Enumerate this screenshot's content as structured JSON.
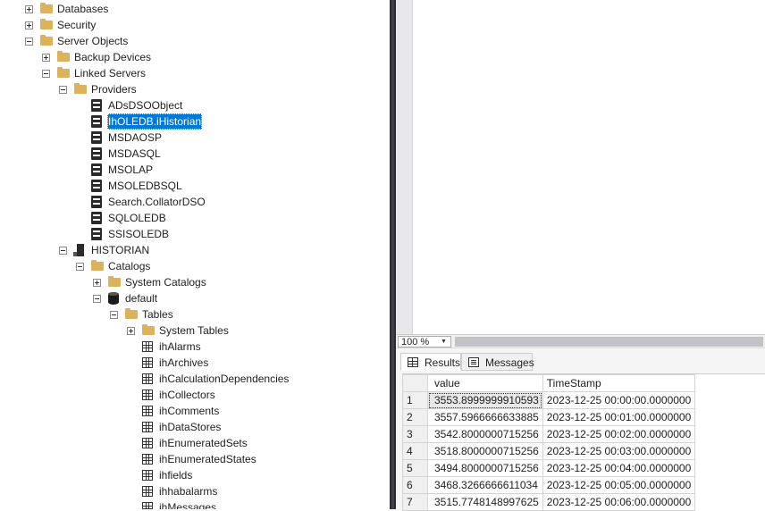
{
  "tree": {
    "nodes": [
      {
        "label": "Databases",
        "icon": "folder-icon",
        "expander": "plus"
      },
      {
        "label": "Security",
        "icon": "folder-icon",
        "expander": "plus"
      },
      {
        "label": "Server Objects",
        "icon": "folder-icon",
        "expander": "minus"
      },
      {
        "label": "Backup Devices",
        "icon": "folder-icon",
        "expander": "plus"
      },
      {
        "label": "Linked Servers",
        "icon": "folder-icon",
        "expander": "minus"
      },
      {
        "label": "Providers",
        "icon": "folder-icon",
        "expander": "minus"
      },
      {
        "label": "ADsDSOObject",
        "icon": "provider-icon",
        "expander": ""
      },
      {
        "label": "IhOLEDB.iHistorian",
        "icon": "provider-icon",
        "expander": "",
        "selected": true
      },
      {
        "label": "MSDAOSP",
        "icon": "provider-icon",
        "expander": ""
      },
      {
        "label": "MSDASQL",
        "icon": "provider-icon",
        "expander": ""
      },
      {
        "label": "MSOLAP",
        "icon": "provider-icon",
        "expander": ""
      },
      {
        "label": "MSOLEDBSQL",
        "icon": "provider-icon",
        "expander": ""
      },
      {
        "label": "Search.CollatorDSO",
        "icon": "provider-icon",
        "expander": ""
      },
      {
        "label": "SQLOLEDB",
        "icon": "provider-icon",
        "expander": ""
      },
      {
        "label": "SSISOLEDB",
        "icon": "provider-icon",
        "expander": ""
      },
      {
        "label": "HISTORIAN",
        "icon": "server-icon",
        "expander": "minus"
      },
      {
        "label": "Catalogs",
        "icon": "folder-icon",
        "expander": "minus"
      },
      {
        "label": "System Catalogs",
        "icon": "folder-icon",
        "expander": "plus"
      },
      {
        "label": "default",
        "icon": "database-icon",
        "expander": "minus"
      },
      {
        "label": "Tables",
        "icon": "folder-icon",
        "expander": "minus"
      },
      {
        "label": "System Tables",
        "icon": "folder-icon",
        "expander": "plus"
      },
      {
        "label": "ihAlarms",
        "icon": "table-icon",
        "expander": ""
      },
      {
        "label": "ihArchives",
        "icon": "table-icon",
        "expander": ""
      },
      {
        "label": "ihCalculationDependencies",
        "icon": "table-icon",
        "expander": ""
      },
      {
        "label": "ihCollectors",
        "icon": "table-icon",
        "expander": ""
      },
      {
        "label": "ihComments",
        "icon": "table-icon",
        "expander": ""
      },
      {
        "label": "ihDataStores",
        "icon": "table-icon",
        "expander": ""
      },
      {
        "label": "ihEnumeratedSets",
        "icon": "table-icon",
        "expander": ""
      },
      {
        "label": "ihEnumeratedStates",
        "icon": "table-icon",
        "expander": ""
      },
      {
        "label": "ihfields",
        "icon": "table-icon",
        "expander": ""
      },
      {
        "label": "ihhabalarms",
        "icon": "table-icon",
        "expander": ""
      },
      {
        "label": "ihMessages",
        "icon": "table-icon",
        "expander": ""
      }
    ]
  },
  "zoom": {
    "value": "100 %"
  },
  "results": {
    "tabs": [
      {
        "label": "Results",
        "icon": "grid-icon",
        "active": true
      },
      {
        "label": "Messages",
        "icon": "messages-icon",
        "active": false
      }
    ],
    "columns": [
      "value",
      "TimeStamp"
    ],
    "rows": [
      {
        "n": "1",
        "value": "3553.8999999910593",
        "time": "2023-12-25 00:00:00.0000000"
      },
      {
        "n": "2",
        "value": "3557.5966666633885",
        "time": "2023-12-25 00:01:00.0000000"
      },
      {
        "n": "3",
        "value": "3542.8000000715256",
        "time": "2023-12-25 00:02:00.0000000"
      },
      {
        "n": "4",
        "value": "3518.8000000715256",
        "time": "2023-12-25 00:03:00.0000000"
      },
      {
        "n": "5",
        "value": "3494.8000000715256",
        "time": "2023-12-25 00:04:00.0000000"
      },
      {
        "n": "6",
        "value": "3468.3266666611034",
        "time": "2023-12-25 00:05:00.0000000"
      },
      {
        "n": "7",
        "value": "3515.7748148997625",
        "time": "2023-12-25 00:06:00.0000000"
      }
    ]
  }
}
